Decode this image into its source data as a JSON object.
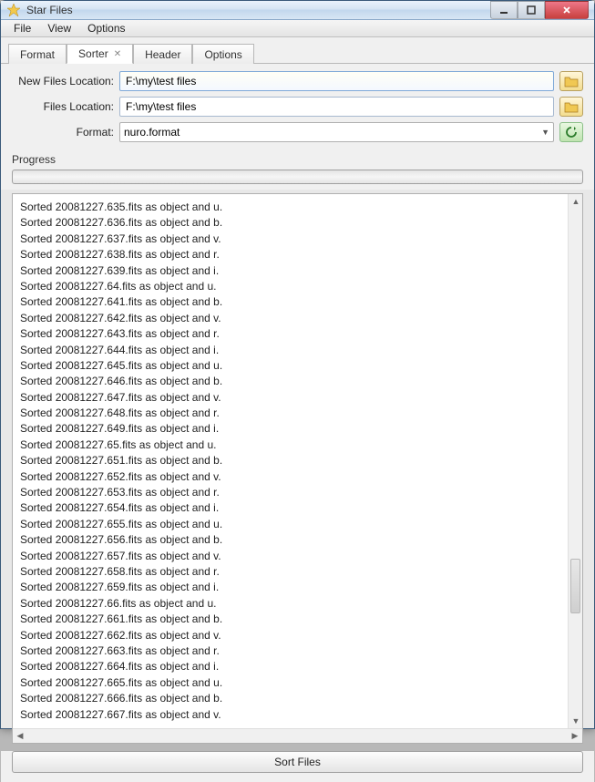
{
  "window": {
    "title": "Star Files"
  },
  "menu": {
    "items": [
      "File",
      "View",
      "Options"
    ]
  },
  "tabs": [
    {
      "label": "Format",
      "active": false,
      "closable": false
    },
    {
      "label": "Sorter",
      "active": true,
      "closable": true
    },
    {
      "label": "Header",
      "active": false,
      "closable": false
    },
    {
      "label": "Options",
      "active": false,
      "closable": false
    }
  ],
  "form": {
    "new_files_location_label": "New Files Location:",
    "new_files_location_value": "F:\\my\\test files",
    "files_location_label": "Files Location:",
    "files_location_value": "F:\\my\\test files",
    "format_label": "Format:",
    "format_value": "nuro.format"
  },
  "progress": {
    "label": "Progress"
  },
  "log": [
    "Sorted 20081227.635.fits as object and u.",
    "Sorted 20081227.636.fits as object and b.",
    "Sorted 20081227.637.fits as object and v.",
    "Sorted 20081227.638.fits as object and r.",
    "Sorted 20081227.639.fits as object and i.",
    "Sorted 20081227.64.fits as object and u.",
    "Sorted 20081227.641.fits as object and b.",
    "Sorted 20081227.642.fits as object and v.",
    "Sorted 20081227.643.fits as object and r.",
    "Sorted 20081227.644.fits as object and i.",
    "Sorted 20081227.645.fits as object and u.",
    "Sorted 20081227.646.fits as object and b.",
    "Sorted 20081227.647.fits as object and v.",
    "Sorted 20081227.648.fits as object and r.",
    "Sorted 20081227.649.fits as object and i.",
    "Sorted 20081227.65.fits as object and u.",
    "Sorted 20081227.651.fits as object and b.",
    "Sorted 20081227.652.fits as object and v.",
    "Sorted 20081227.653.fits as object and r.",
    "Sorted 20081227.654.fits as object and i.",
    "Sorted 20081227.655.fits as object and u.",
    "Sorted 20081227.656.fits as object and b.",
    "Sorted 20081227.657.fits as object and v.",
    "Sorted 20081227.658.fits as object and r.",
    "Sorted 20081227.659.fits as object and i.",
    "Sorted 20081227.66.fits as object and u.",
    "Sorted 20081227.661.fits as object and b.",
    "Sorted 20081227.662.fits as object and v.",
    "Sorted 20081227.663.fits as object and r.",
    "Sorted 20081227.664.fits as object and i.",
    "Sorted 20081227.665.fits as object and u.",
    "Sorted 20081227.666.fits as object and b.",
    "Sorted 20081227.667.fits as object and v."
  ],
  "buttons": {
    "sort_files": "Sort Files"
  }
}
